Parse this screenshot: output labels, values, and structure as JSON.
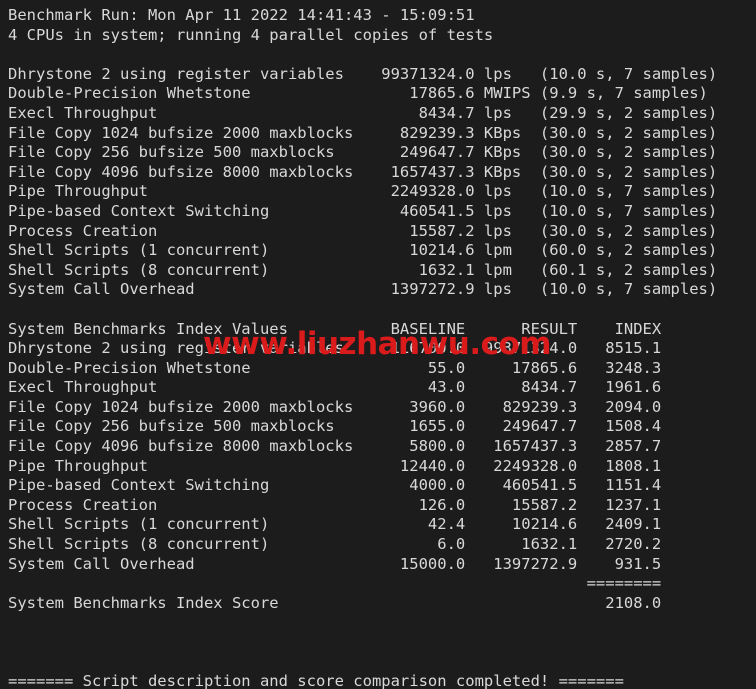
{
  "terminal": {
    "colors": {
      "background": "#1c1c1c",
      "foreground": "#d8d8d8",
      "watermark": "#d91b1b"
    },
    "top_rule": "--------------------------------------------------------------------------",
    "header": {
      "run_line": "Benchmark Run: Mon Apr 11 2022 14:41:43 - 15:09:51",
      "cpu_line": "4 CPUs in system; running 4 parallel copies of tests"
    },
    "raw_results": {
      "rows": [
        {
          "name": "Dhrystone 2 using register variables",
          "value": "99371324.0",
          "unit": "lps",
          "detail": "(10.0 s, 7 samples)"
        },
        {
          "name": "Double-Precision Whetstone",
          "value": "17865.6",
          "unit": "MWIPS",
          "detail": "(9.9 s, 7 samples)"
        },
        {
          "name": "Execl Throughput",
          "value": "8434.7",
          "unit": "lps",
          "detail": "(29.9 s, 2 samples)"
        },
        {
          "name": "File Copy 1024 bufsize 2000 maxblocks",
          "value": "829239.3",
          "unit": "KBps",
          "detail": "(30.0 s, 2 samples)"
        },
        {
          "name": "File Copy 256 bufsize 500 maxblocks",
          "value": "249647.7",
          "unit": "KBps",
          "detail": "(30.0 s, 2 samples)"
        },
        {
          "name": "File Copy 4096 bufsize 8000 maxblocks",
          "value": "1657437.3",
          "unit": "KBps",
          "detail": "(30.0 s, 2 samples)"
        },
        {
          "name": "Pipe Throughput",
          "value": "2249328.0",
          "unit": "lps",
          "detail": "(10.0 s, 7 samples)"
        },
        {
          "name": "Pipe-based Context Switching",
          "value": "460541.5",
          "unit": "lps",
          "detail": "(10.0 s, 7 samples)"
        },
        {
          "name": "Process Creation",
          "value": "15587.2",
          "unit": "lps",
          "detail": "(30.0 s, 2 samples)"
        },
        {
          "name": "Shell Scripts (1 concurrent)",
          "value": "10214.6",
          "unit": "lpm",
          "detail": "(60.0 s, 2 samples)"
        },
        {
          "name": "Shell Scripts (8 concurrent)",
          "value": "1632.1",
          "unit": "lpm",
          "detail": "(60.1 s, 2 samples)"
        },
        {
          "name": "System Call Overhead",
          "value": "1397272.9",
          "unit": "lps",
          "detail": "(10.0 s, 7 samples)"
        }
      ]
    },
    "index_values": {
      "title": "System Benchmarks Index Values",
      "columns": [
        "BASELINE",
        "RESULT",
        "INDEX"
      ],
      "rows": [
        {
          "name": "Dhrystone 2 using register variables",
          "baseline": "116700.0",
          "result": "99371324.0",
          "index": "8515.1"
        },
        {
          "name": "Double-Precision Whetstone",
          "baseline": "55.0",
          "result": "17865.6",
          "index": "3248.3"
        },
        {
          "name": "Execl Throughput",
          "baseline": "43.0",
          "result": "8434.7",
          "index": "1961.6"
        },
        {
          "name": "File Copy 1024 bufsize 2000 maxblocks",
          "baseline": "3960.0",
          "result": "829239.3",
          "index": "2094.0"
        },
        {
          "name": "File Copy 256 bufsize 500 maxblocks",
          "baseline": "1655.0",
          "result": "249647.7",
          "index": "1508.4"
        },
        {
          "name": "File Copy 4096 bufsize 8000 maxblocks",
          "baseline": "5800.0",
          "result": "1657437.3",
          "index": "2857.7"
        },
        {
          "name": "Pipe Throughput",
          "baseline": "12440.0",
          "result": "2249328.0",
          "index": "1808.1"
        },
        {
          "name": "Pipe-based Context Switching",
          "baseline": "4000.0",
          "result": "460541.5",
          "index": "1151.4"
        },
        {
          "name": "Process Creation",
          "baseline": "126.0",
          "result": "15587.2",
          "index": "1237.1"
        },
        {
          "name": "Shell Scripts (1 concurrent)",
          "baseline": "42.4",
          "result": "10214.6",
          "index": "2409.1"
        },
        {
          "name": "Shell Scripts (8 concurrent)",
          "baseline": "6.0",
          "result": "1632.1",
          "index": "2720.2"
        },
        {
          "name": "System Call Overhead",
          "baseline": "15000.0",
          "result": "1397272.9",
          "index": "931.5"
        }
      ],
      "separator": "========",
      "score_label": "System Benchmarks Index Score",
      "score_value": "2108.0"
    },
    "footer": "======= Script description and score comparison completed! =======",
    "watermark_text": "www.liuzhanwu.com"
  }
}
